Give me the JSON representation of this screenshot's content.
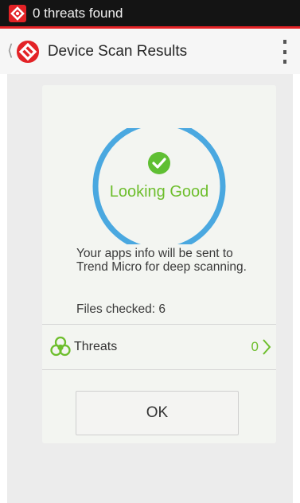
{
  "status_bar": {
    "notification_text": "0 threats found",
    "app_icon": "trend-micro-logo-icon"
  },
  "action_bar": {
    "title": "Device Scan Results",
    "up_icon": "back-caret-icon",
    "menu_icon": "overflow-menu-icon"
  },
  "scan_result": {
    "status_icon": "check-circle-icon",
    "status_label": "Looking Good",
    "info_text": "Your apps info will be sent to Trend Micro for deep scanning.",
    "files_checked_label": "Files checked: 6"
  },
  "threats": {
    "icon": "biohazard-icon",
    "label": "Threats",
    "count": "0",
    "chevron_icon": "chevron-right-icon"
  },
  "ok_button": {
    "label": "OK"
  },
  "colors": {
    "accent_red": "#e32226",
    "ring_blue": "#4aa8e0",
    "success_green": "#6dbe2c",
    "check_green": "#5fbf33"
  }
}
